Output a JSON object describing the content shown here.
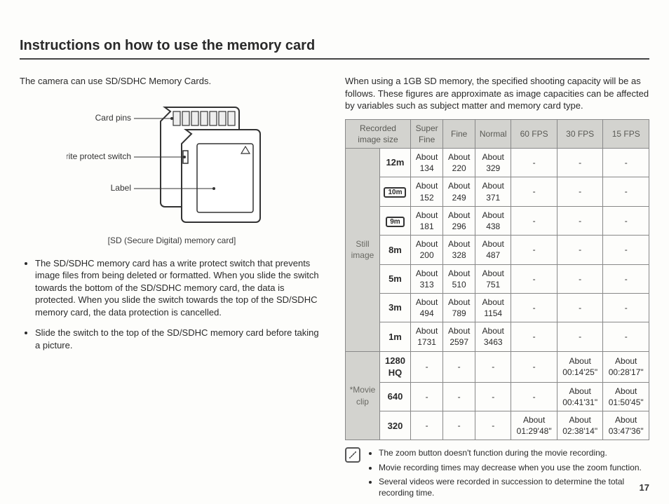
{
  "title": "Instructions on how to use the memory card",
  "left": {
    "intro": "The camera can use SD/SDHC Memory Cards.",
    "labels": {
      "card_pins": "Card pins",
      "write_protect": "Write protect switch",
      "label": "Label"
    },
    "caption": "[SD (Secure Digital) memory card]",
    "bullets": [
      "The SD/SDHC memory card has a write protect switch that prevents image files from being deleted or formatted. When you slide the switch towards the bottom of the SD/SDHC memory card, the data is protected. When you slide the switch towards the top of the SD/SDHC memory card, the data protection is cancelled.",
      "Slide the switch to the top of the SD/SDHC memory card before taking a picture."
    ]
  },
  "right": {
    "intro": "When using a 1GB SD memory, the specified shooting capacity will be as follows. These figures are approximate as image capacities can be affected by variables such as subject matter and memory card type.",
    "headers": {
      "recorded": "Recorded image size",
      "superfine": "Super Fine",
      "fine": "Fine",
      "normal": "Normal",
      "fps60": "60 FPS",
      "fps30": "30 FPS",
      "fps15": "15 FPS"
    },
    "groups": {
      "still": "Still image",
      "movie": "*Movie clip"
    },
    "still_rows": [
      {
        "size": "12m",
        "sf": "About 134",
        "f": "About 220",
        "n": "About 329",
        "c60": "-",
        "c30": "-",
        "c15": "-"
      },
      {
        "size": "10m",
        "sf": "About 152",
        "f": "About 249",
        "n": "About 371",
        "c60": "-",
        "c30": "-",
        "c15": "-"
      },
      {
        "size": "9m",
        "sf": "About 181",
        "f": "About 296",
        "n": "About 438",
        "c60": "-",
        "c30": "-",
        "c15": "-"
      },
      {
        "size": "8m",
        "sf": "About 200",
        "f": "About 328",
        "n": "About 487",
        "c60": "-",
        "c30": "-",
        "c15": "-"
      },
      {
        "size": "5m",
        "sf": "About 313",
        "f": "About 510",
        "n": "About 751",
        "c60": "-",
        "c30": "-",
        "c15": "-"
      },
      {
        "size": "3m",
        "sf": "About 494",
        "f": "About 789",
        "n": "About 1154",
        "c60": "-",
        "c30": "-",
        "c15": "-"
      },
      {
        "size": "1m",
        "sf": "About 1731",
        "f": "About 2597",
        "n": "About 3463",
        "c60": "-",
        "c30": "-",
        "c15": "-"
      }
    ],
    "movie_rows": [
      {
        "size": "1280 HQ",
        "sf": "-",
        "f": "-",
        "n": "-",
        "c60": "-",
        "c30": "About 00:14'25\"",
        "c15": "About 00:28'17\""
      },
      {
        "size": "640",
        "sf": "-",
        "f": "-",
        "n": "-",
        "c60": "-",
        "c30": "About 00:41'31\"",
        "c15": "About 01:50'45\""
      },
      {
        "size": "320",
        "sf": "-",
        "f": "-",
        "n": "-",
        "c60": "About 01:29'48\"",
        "c30": "About 02:38'14\"",
        "c15": "About 03:47'36\""
      }
    ],
    "notes": [
      "The zoom button doesn't function during the movie recording.",
      "Movie recording times may decrease when you use the zoom function.",
      "Several videos were recorded in succession to determine the total recording time."
    ]
  },
  "page_number": "17"
}
